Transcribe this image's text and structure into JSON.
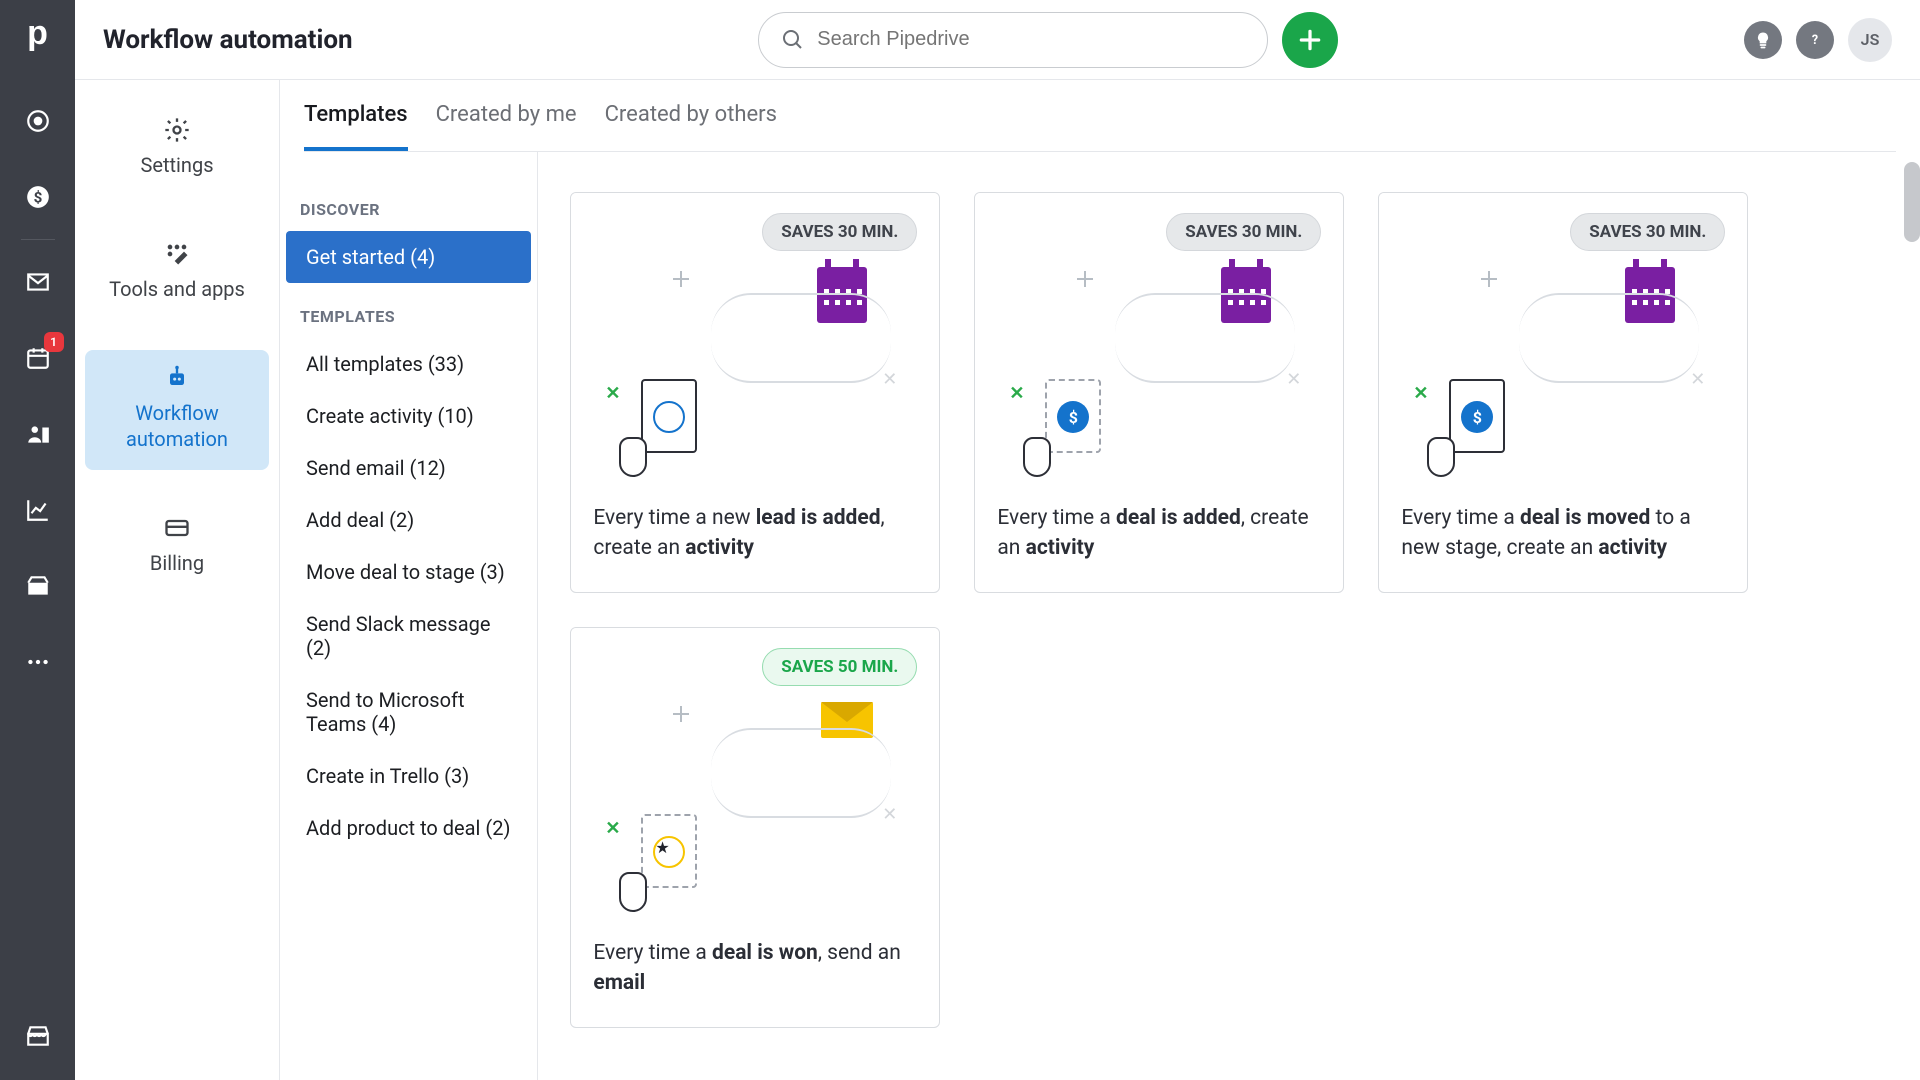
{
  "header": {
    "title": "Workflow automation",
    "search_placeholder": "Search Pipedrive",
    "avatar_initials": "JS"
  },
  "rail": {
    "badge": "1"
  },
  "settings_sidebar": {
    "items": [
      {
        "label": "Settings"
      },
      {
        "label": "Tools and apps"
      },
      {
        "label": "Workflow automation"
      },
      {
        "label": "Billing"
      }
    ],
    "active_index": 2
  },
  "tabs": {
    "items": [
      "Templates",
      "Created by me",
      "Created by others"
    ],
    "active_index": 0
  },
  "categories": {
    "discover_label": "DISCOVER",
    "templates_label": "TEMPLATES",
    "discover": [
      {
        "label": "Get started (4)"
      }
    ],
    "templates": [
      {
        "label": "All templates (33)"
      },
      {
        "label": "Create activity (10)"
      },
      {
        "label": "Send email (12)"
      },
      {
        "label": "Add deal (2)"
      },
      {
        "label": "Move deal to stage (3)"
      },
      {
        "label": "Send Slack message (2)"
      },
      {
        "label": "Send to Microsoft Teams (4)"
      },
      {
        "label": "Create in Trello (3)"
      },
      {
        "label": "Add product to deal (2)"
      }
    ],
    "discover_active": 0
  },
  "cards": [
    {
      "badge": "SAVES 30 MIN.",
      "badge_style": "grey",
      "pre": "Every time a new ",
      "bold1": "lead is added",
      "mid": ", create an ",
      "bold2": "activity",
      "post": "",
      "illus": "lead"
    },
    {
      "badge": "SAVES 30 MIN.",
      "badge_style": "grey",
      "pre": "Every time a ",
      "bold1": "deal is added",
      "mid": ", create an ",
      "bold2": "activity",
      "post": "",
      "illus": "deal-added"
    },
    {
      "badge": "SAVES 30 MIN.",
      "badge_style": "grey",
      "pre": "Every time a ",
      "bold1": "deal is moved",
      "mid": " to a new stage, create an ",
      "bold2": "activity",
      "post": "",
      "illus": "deal-moved"
    },
    {
      "badge": "SAVES 50 MIN.",
      "badge_style": "green",
      "pre": "Every time a ",
      "bold1": "deal is won",
      "mid": ", send an ",
      "bold2": "email",
      "post": "",
      "illus": "deal-won"
    }
  ]
}
